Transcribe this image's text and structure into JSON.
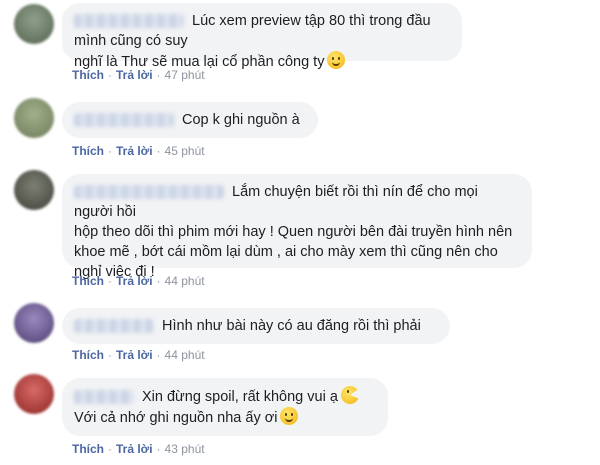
{
  "comments": [
    {
      "text_lines": [
        "Lúc xem preview tập 80 thì trong đầu mình cũng có suy",
        "nghĩ là Thư sẽ mua lại cổ phần công ty"
      ],
      "emoji": "smile-emoji",
      "like_label": "Thích",
      "reply_label": "Trả lời",
      "time": "47 phút",
      "avatar_color": "#6f7f6a"
    },
    {
      "text_lines": [
        "Cop k ghi nguồn à"
      ],
      "emoji": "",
      "like_label": "Thích",
      "reply_label": "Trả lời",
      "time": "45 phút",
      "avatar_color": "#8a9a6e"
    },
    {
      "text_lines": [
        "Lắm chuyện biết rồi thì nín để cho mọi người hồi",
        "hộp theo dõi thì phim mới hay ! Quen người bên đài truyền hình nên",
        "khoe mẽ , bớt cái mồm lại dùm , ai cho mày xem thì cũng nên cho",
        "nghỉ việc đi !"
      ],
      "emoji": "",
      "like_label": "Thích",
      "reply_label": "Trả lời",
      "time": "44 phút",
      "avatar_color": "#5c5f55"
    },
    {
      "text_lines": [
        "Hình như bài này có au đăng rồi thì phải"
      ],
      "emoji": "",
      "like_label": "Thích",
      "reply_label": "Trả lời",
      "time": "44 phút",
      "avatar_color": "#6b5a8e"
    },
    {
      "text_lines": [
        "Xin đừng spoil, rất không vui ạ",
        "Với cả nhớ ghi nguồn nha ấy ơi"
      ],
      "emoji": "pacman-emoji",
      "emoji2": "smile-emoji",
      "like_label": "Thích",
      "reply_label": "Trả lời",
      "time": "43 phút",
      "avatar_color": "#b0413e"
    }
  ],
  "separator": "·"
}
